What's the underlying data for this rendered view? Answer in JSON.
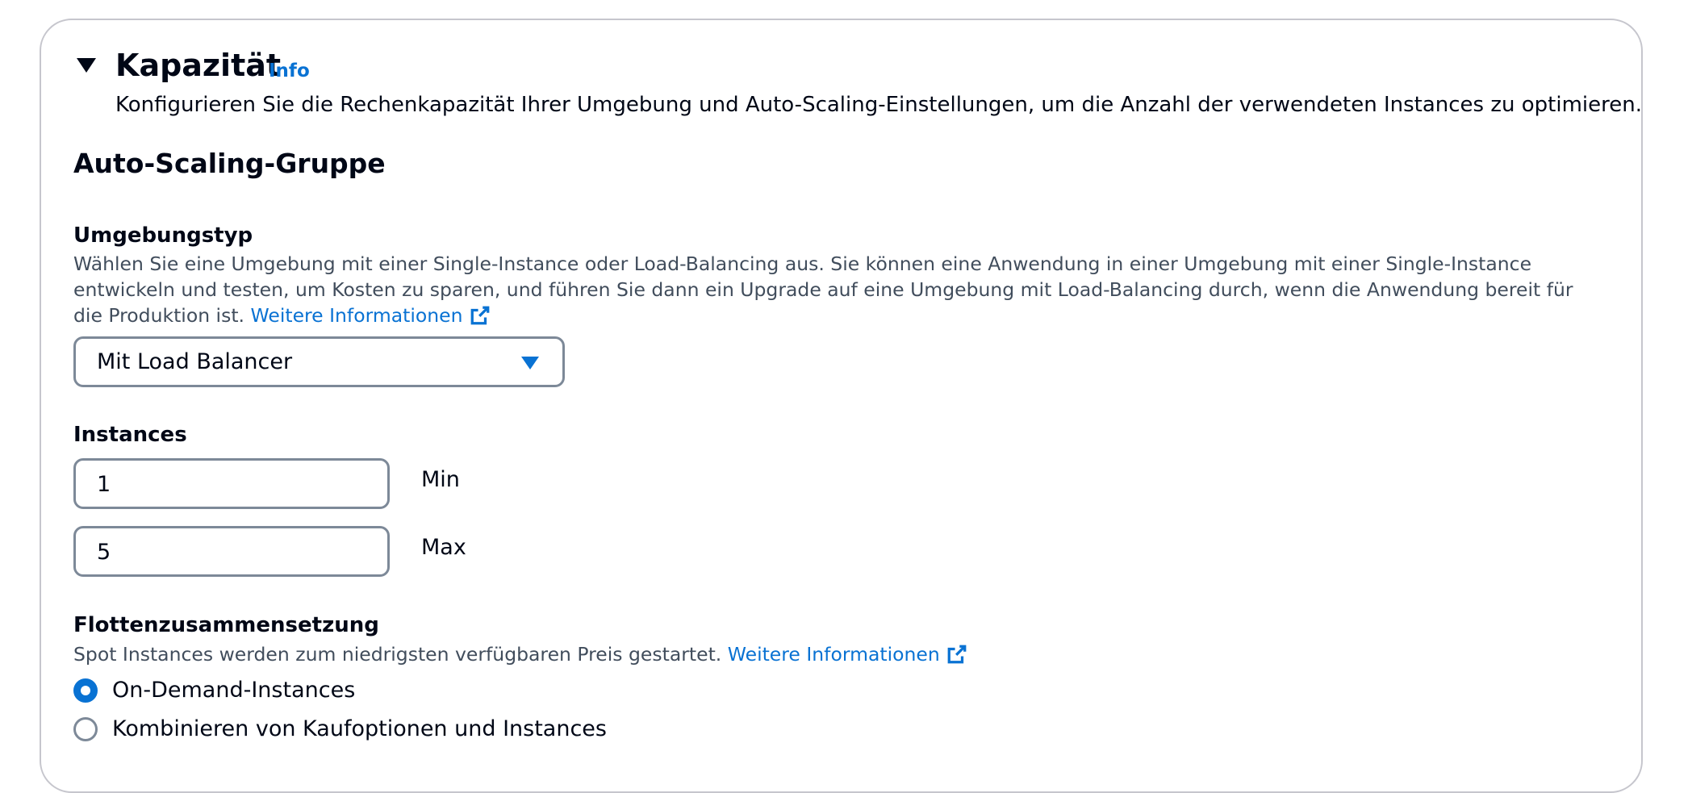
{
  "section": {
    "title": "Kapazität",
    "info_link": "Info",
    "description": "Konfigurieren Sie die Rechenkapazität Ihrer Umgebung und Auto-Scaling-Einstellungen, um die Anzahl der verwendeten Instances zu optimieren."
  },
  "auto_scaling": {
    "heading": "Auto-Scaling-Gruppe",
    "environment_type": {
      "label": "Umgebungstyp",
      "description": "Wählen Sie eine Umgebung mit einer Single-Instance oder Load-Balancing aus. Sie können eine Anwendung in einer Umgebung mit einer Single-Instance entwickeln und testen, um Kosten zu sparen, und führen Sie dann ein Upgrade auf eine Umgebung mit Load-Balancing durch, wenn die Anwendung bereit für die Produktion ist.",
      "learn_more": "Weitere Informationen",
      "selected": "Mit Load Balancer"
    },
    "instances": {
      "label": "Instances",
      "min_value": "1",
      "min_label": "Min",
      "max_value": "5",
      "max_label": "Max"
    },
    "fleet": {
      "label": "Flottenzusammensetzung",
      "description": "Spot Instances werden zum niedrigsten verfügbaren Preis gestartet.",
      "learn_more": "Weitere Informationen",
      "options": [
        {
          "label": "On-Demand-Instances",
          "checked": true
        },
        {
          "label": "Kombinieren von Kaufoptionen und Instances",
          "checked": false
        }
      ]
    }
  },
  "colors": {
    "link": "#0972d3",
    "text": "#000716",
    "secondary_text": "#414d5c",
    "border": "#7d8998"
  },
  "icons": [
    "caret-down-icon",
    "external-link-icon",
    "select-caret-icon"
  ]
}
